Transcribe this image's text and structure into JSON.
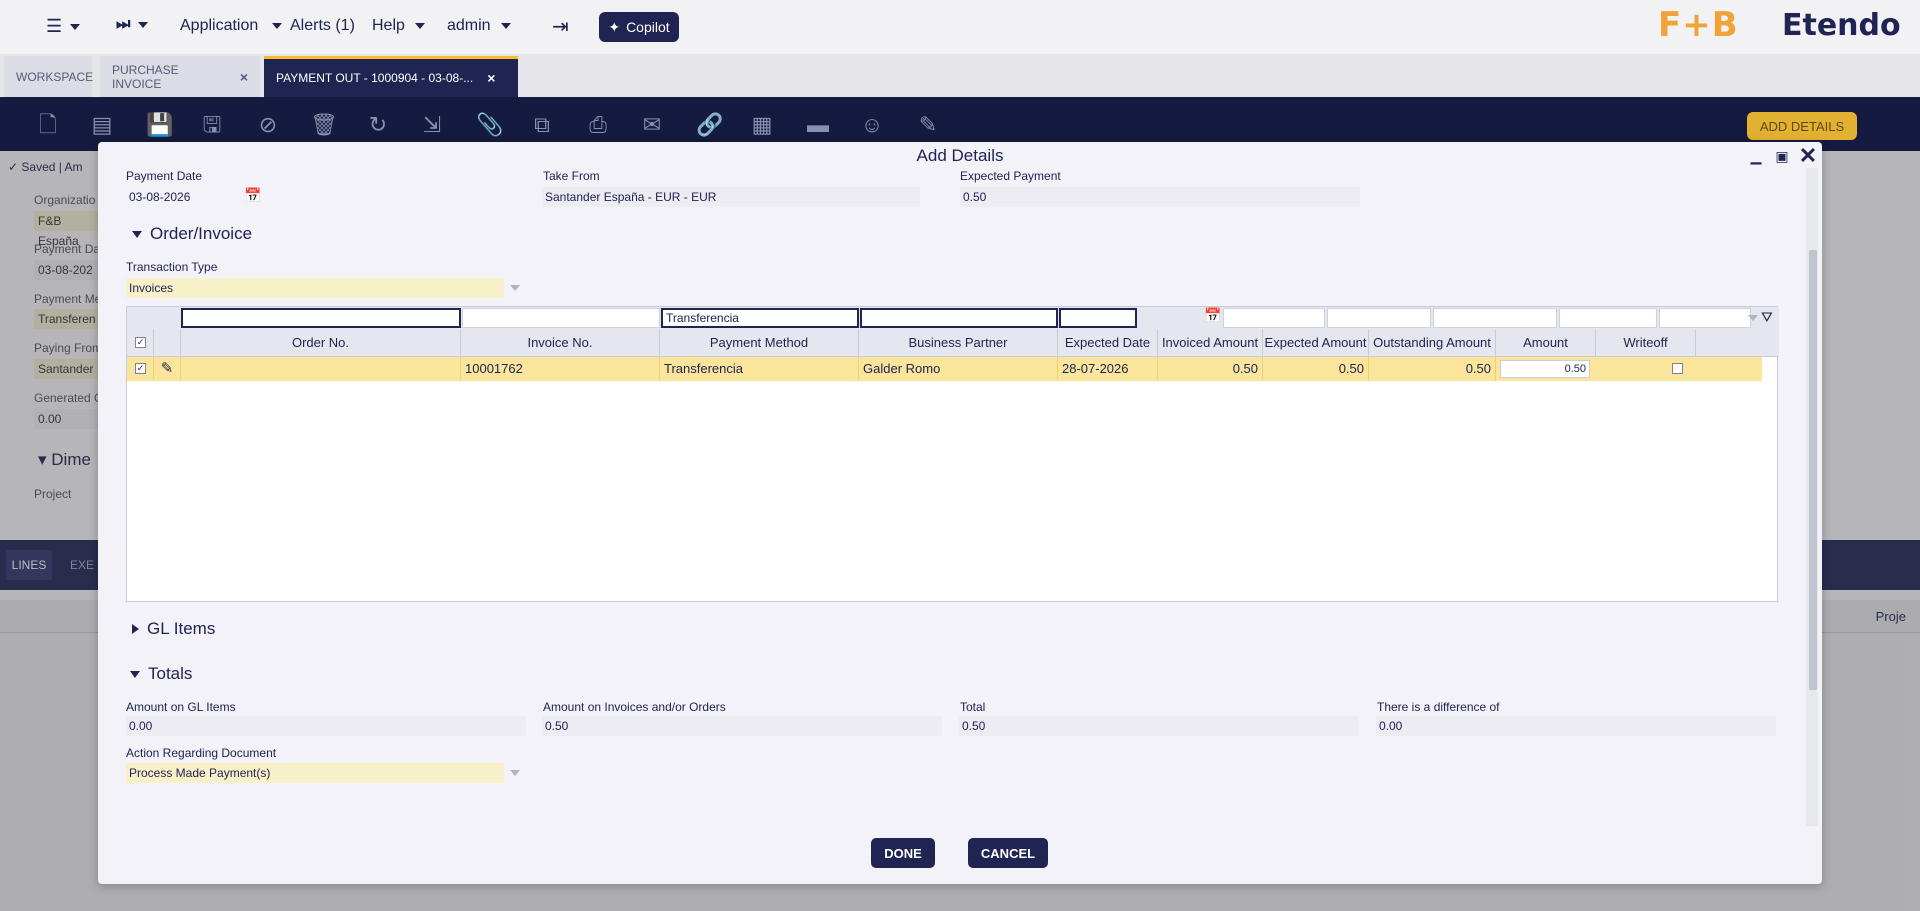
{
  "topnav": {
    "application": "Application",
    "alerts": "Alerts (1)",
    "help": "Help",
    "user": "admin",
    "copilot": "Copilot",
    "logo_fb": "F+B",
    "logo_etendo": "Etendo"
  },
  "tabs": [
    {
      "label": "WORKSPACE"
    },
    {
      "label": "PURCHASE INVOICE"
    },
    {
      "label": "PAYMENT OUT - 1000904 - 03-08-..."
    }
  ],
  "toolbar": {
    "add_details": "ADD DETAILS"
  },
  "background_form": {
    "status": "Saved | Am",
    "organization_label": "Organizatio",
    "organization_value": "F&B España",
    "payment_date_label": "Payment Da",
    "payment_date_value": "03-08-202",
    "payment_method_label": "Payment Me",
    "payment_method_value": "Transferen",
    "paying_from_label": "Paying From",
    "paying_from_value": "Santander",
    "generated_label": "Generated C",
    "generated_value": "0.00",
    "dimensions_label": "Dime",
    "project_label": "Project",
    "lines_tab": "LINES",
    "exe_tab": "EXE",
    "grid_proj": "Proje"
  },
  "modal": {
    "title": "Add Details",
    "payment_date_label": "Payment Date",
    "payment_date_value": "03-08-2026",
    "take_from_label": "Take From",
    "take_from_value": "Santander España - EUR - EUR",
    "expected_payment_label": "Expected Payment",
    "expected_payment_value": "0.50",
    "order_invoice_section": "Order/Invoice",
    "transaction_type_label": "Transaction Type",
    "transaction_type_value": "Invoices",
    "grid": {
      "filter_payment_method": "Transferencia",
      "columns": [
        "Order No.",
        "Invoice No.",
        "Payment Method",
        "Business Partner",
        "Expected Date",
        "Invoiced Amount",
        "Expected Amount",
        "Outstanding Amount",
        "Amount",
        "Writeoff"
      ],
      "rows": [
        {
          "order_no": "",
          "invoice_no": "10001762",
          "payment_method": "Transferencia",
          "business_partner": "Galder Romo",
          "expected_date": "28-07-2026",
          "invoiced_amount": "0.50",
          "expected_amount": "0.50",
          "outstanding_amount": "0.50",
          "amount": "0.50",
          "writeoff": false,
          "selected": true
        }
      ]
    },
    "gl_items_section": "GL Items",
    "totals_section": "Totals",
    "amount_gl_label": "Amount on GL Items",
    "amount_gl_value": "0.00",
    "amount_invoices_label": "Amount on Invoices and/or Orders",
    "amount_invoices_value": "0.50",
    "total_label": "Total",
    "total_value": "0.50",
    "difference_label": "There is a difference of",
    "difference_value": "0.00",
    "action_label": "Action Regarding Document",
    "action_value": "Process Made Payment(s)",
    "done": "DONE",
    "cancel": "CANCEL"
  }
}
